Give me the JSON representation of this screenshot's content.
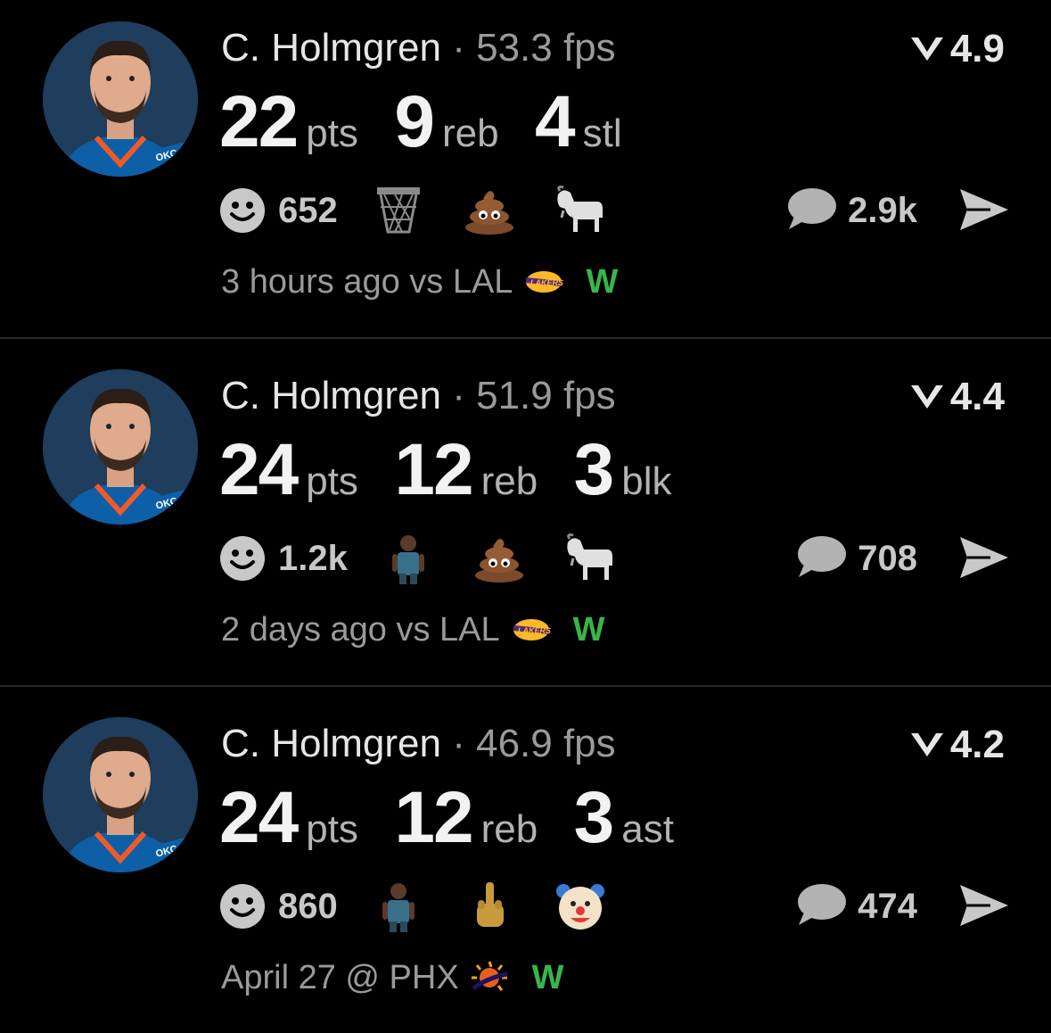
{
  "colors": {
    "background": "#000000",
    "primary_text": "#e6e6e6",
    "secondary_text": "#9a9a9a",
    "win": "#39b54a",
    "divider": "#2a2a2a",
    "okc_blue": "#007ac1"
  },
  "icons": {
    "rating": "fantasy-v-icon",
    "reaction": "smiley-face-icon",
    "comment": "speech-bubble-icon",
    "share": "send-arrow-icon"
  },
  "posts": [
    {
      "player": "C. Holmgren",
      "separator": "·",
      "fps": "53.3 fps",
      "rating": "4.9",
      "stats": [
        {
          "value": "22",
          "unit": "pts"
        },
        {
          "value": "9",
          "unit": "reb"
        },
        {
          "value": "4",
          "unit": "stl"
        }
      ],
      "reaction_count": "652",
      "reaction_emojis": [
        "basketball-hoop-icon",
        "poop-emoji-icon",
        "goat-emoji-icon"
      ],
      "comment_count": "2.9k",
      "footer": "3 hours ago vs LAL",
      "opponent_logo": "lakers-logo-icon",
      "result": "W"
    },
    {
      "player": "C. Holmgren",
      "separator": "·",
      "fps": "51.9 fps",
      "rating": "4.4",
      "stats": [
        {
          "value": "24",
          "unit": "pts"
        },
        {
          "value": "12",
          "unit": "reb"
        },
        {
          "value": "3",
          "unit": "blk"
        }
      ],
      "reaction_count": "1.2k",
      "reaction_emojis": [
        "player-sticker-icon",
        "poop-emoji-icon",
        "goat-emoji-icon"
      ],
      "comment_count": "708",
      "footer": "2 days ago vs LAL",
      "opponent_logo": "lakers-logo-icon",
      "result": "W"
    },
    {
      "player": "C. Holmgren",
      "separator": "·",
      "fps": "46.9 fps",
      "rating": "4.2",
      "stats": [
        {
          "value": "24",
          "unit": "pts"
        },
        {
          "value": "12",
          "unit": "reb"
        },
        {
          "value": "3",
          "unit": "ast"
        }
      ],
      "reaction_count": "860",
      "reaction_emojis": [
        "player-sticker-icon",
        "middle-finger-emoji-icon",
        "clown-emoji-icon"
      ],
      "comment_count": "474",
      "footer": "April 27 @ PHX",
      "opponent_logo": "suns-logo-icon",
      "result": "W"
    }
  ]
}
